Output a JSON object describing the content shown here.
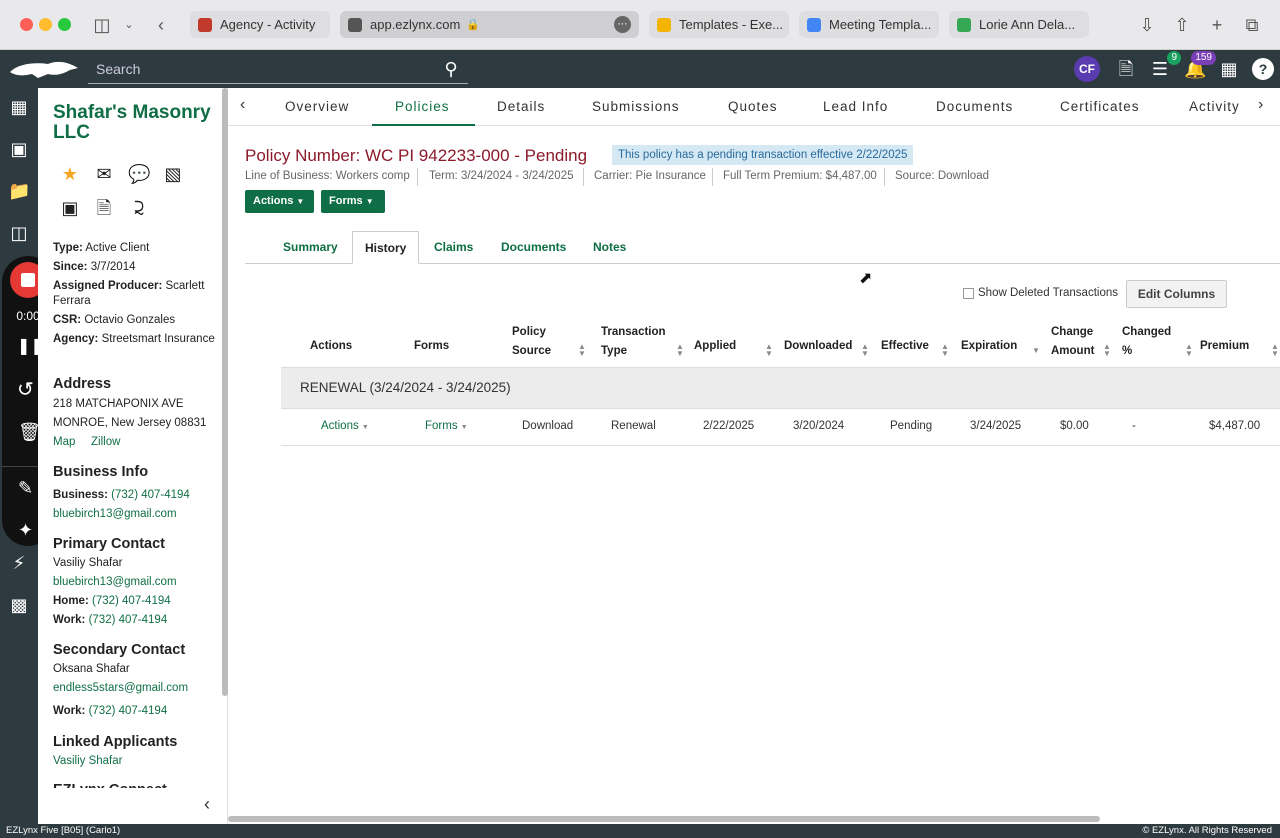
{
  "browser": {
    "tabs": [
      {
        "label": "Agency - Activity",
        "color": "#c0392b"
      },
      {
        "label": "app.ezlynx.com",
        "color": "#555555"
      },
      {
        "label": "Templates - Exe...",
        "color": "#f4b400"
      },
      {
        "label": "Meeting Templa...",
        "color": "#4285f4"
      },
      {
        "label": "Lorie Ann Dela...",
        "color": "#34a853"
      }
    ]
  },
  "header": {
    "search_placeholder": "Search",
    "user_initials": "CF",
    "tasks_badge": "9",
    "notifications_badge": "159",
    "help": "?"
  },
  "recorder": {
    "time": "0:00"
  },
  "sidebar": {
    "client_name": "Shafar's Masonry LLC",
    "type_label": "Type:",
    "type_value": "Active Client",
    "since_label": "Since:",
    "since_value": "3/7/2014",
    "producer_label": "Assigned Producer:",
    "producer_value": "Scarlett Ferrara",
    "csr_label": "CSR:",
    "csr_value": "Octavio Gonzales",
    "agency_label": "Agency:",
    "agency_value": "Streetsmart Insurance",
    "address_head": "Address",
    "address_line1": "218 MATCHAPONIX AVE",
    "address_line2": "MONROE, New Jersey 08831",
    "map_link": "Map",
    "zillow_link": "Zillow",
    "business_head": "Business Info",
    "business_phone_label": "Business:",
    "business_phone": "(732) 407-4194",
    "business_email": "bluebirch13@gmail.com",
    "primary_head": "Primary Contact",
    "primary_name": "Vasiliy Shafar",
    "primary_email": "bluebirch13@gmail.com",
    "home_label": "Home:",
    "home_phone": "(732) 407-4194",
    "work_label": "Work:",
    "work_phone": "(732) 407-4194",
    "secondary_head": "Secondary Contact",
    "secondary_name": "Oksana Shafar",
    "secondary_email": "endless5stars@gmail.com",
    "secondary_work_label": "Work:",
    "secondary_work_phone": "(732) 407-4194",
    "linked_head": "Linked Applicants",
    "linked_name": "Vasiliy Shafar",
    "cut_head": "EZLynx Connect"
  },
  "top_tabs": [
    "Overview",
    "Policies",
    "Details",
    "Submissions",
    "Quotes",
    "Lead Info",
    "Documents",
    "Certificates",
    "Activity"
  ],
  "policy": {
    "title": "Policy Number: WC PI 942233-000 - Pending",
    "pending_notice": "This policy has a pending transaction effective 2/22/2025",
    "lob_label": "Line of Business:",
    "lob_value": "Workers comp",
    "term_label": "Term:",
    "term_value": "3/24/2024 - 3/24/2025",
    "carrier_label": "Carrier:",
    "carrier_value": "Pie Insurance",
    "premium_label": "Full Term Premium:",
    "premium_value": "$4,487.00",
    "source_label": "Source:",
    "source_value": "Download",
    "actions_btn": "Actions",
    "forms_btn": "Forms"
  },
  "sub_tabs": [
    "Summary",
    "History",
    "Claims",
    "Documents",
    "Notes"
  ],
  "history": {
    "show_deleted": "Show Deleted Transactions",
    "edit_columns": "Edit Columns",
    "columns": [
      "Actions",
      "Forms",
      "Policy Source",
      "Transaction Type",
      "Applied",
      "Downloaded",
      "Effective",
      "Expiration",
      "Change Amount",
      "Changed %",
      "Premium"
    ],
    "group_label": "RENEWAL (3/24/2024 - 3/24/2025)",
    "row": {
      "actions": "Actions",
      "forms": "Forms",
      "source": "Download",
      "type": "Renewal",
      "applied": "2/22/2025",
      "downloaded": "3/20/2024",
      "effective": "Pending",
      "expiration": "3/24/2025",
      "change_amount": "$0.00",
      "changed_pct": "-",
      "premium": "$4,487.00"
    }
  },
  "footer": {
    "left": "EZLynx Five [B05] (Carlo1)",
    "right": "© EZLynx. All Rights Reserved"
  }
}
